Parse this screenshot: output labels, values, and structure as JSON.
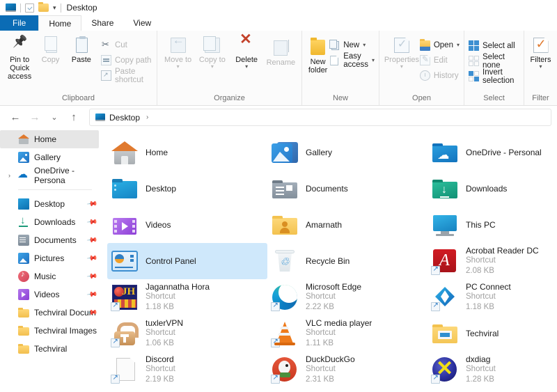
{
  "titlebar": {
    "title": "Desktop",
    "icons": [
      "desktop-icon",
      "checkbox-icon",
      "folder-icon",
      "dropdown-caret"
    ]
  },
  "ribbon_tabs": [
    {
      "label": "File",
      "active": false,
      "accent": true
    },
    {
      "label": "Home",
      "active": true
    },
    {
      "label": "Share",
      "active": false
    },
    {
      "label": "View",
      "active": false
    }
  ],
  "ribbon": {
    "groups": [
      {
        "label": "Clipboard",
        "big": [
          {
            "label": "Pin to Quick access",
            "icon": "pin-icon",
            "disabled": false
          },
          {
            "label": "Copy",
            "icon": "copy-icon",
            "disabled": true
          },
          {
            "label": "Paste",
            "icon": "paste-icon",
            "disabled": false
          }
        ],
        "small": [
          {
            "label": "Cut",
            "icon": "scissors-icon",
            "disabled": true
          },
          {
            "label": "Copy path",
            "icon": "copy-path-icon",
            "disabled": true
          },
          {
            "label": "Paste shortcut",
            "icon": "paste-shortcut-icon",
            "disabled": true
          }
        ]
      },
      {
        "label": "Organize",
        "big": [
          {
            "label": "Move to",
            "icon": "move-to-icon",
            "disabled": true,
            "caret": true
          },
          {
            "label": "Copy to",
            "icon": "copy-to-icon",
            "disabled": true,
            "caret": true
          },
          {
            "label": "Delete",
            "icon": "delete-icon",
            "disabled": false,
            "caret": true
          },
          {
            "label": "Rename",
            "icon": "rename-icon",
            "disabled": true
          }
        ],
        "small": []
      },
      {
        "label": "New",
        "big": [
          {
            "label": "New folder",
            "icon": "new-folder-icon",
            "disabled": false
          }
        ],
        "small": [
          {
            "label": "New",
            "icon": "new-item-icon",
            "disabled": false,
            "caret": true
          },
          {
            "label": "Easy access",
            "icon": "easy-access-icon",
            "disabled": false,
            "caret": true
          }
        ]
      },
      {
        "label": "Open",
        "big": [
          {
            "label": "Properties",
            "icon": "properties-icon",
            "disabled": true,
            "caret": true
          }
        ],
        "small": [
          {
            "label": "Open",
            "icon": "open-icon",
            "disabled": false,
            "caret": true
          },
          {
            "label": "Edit",
            "icon": "edit-icon",
            "disabled": true
          },
          {
            "label": "History",
            "icon": "history-icon",
            "disabled": true
          }
        ]
      },
      {
        "label": "Select",
        "big": [],
        "small": [
          {
            "label": "Select all",
            "icon": "select-all-icon",
            "disabled": false
          },
          {
            "label": "Select none",
            "icon": "select-none-icon",
            "disabled": false
          },
          {
            "label": "Invert selection",
            "icon": "invert-selection-icon",
            "disabled": false
          }
        ]
      },
      {
        "label": "Filter",
        "big": [
          {
            "label": "Filters",
            "icon": "filters-icon",
            "disabled": false,
            "caret": true
          }
        ],
        "small": []
      }
    ]
  },
  "addressbar": {
    "back": "←",
    "forward": "→",
    "recent": "⌄",
    "up": "↑",
    "path_icon": "desktop-icon",
    "path": "Desktop",
    "chevron": "›"
  },
  "sidebar": {
    "items": [
      {
        "label": "Home",
        "icon": "home-icon",
        "selected": true,
        "pinned": false,
        "expandable": false
      },
      {
        "label": "Gallery",
        "icon": "gallery-icon",
        "selected": false,
        "pinned": false,
        "expandable": false
      },
      {
        "label": "OneDrive - Persona",
        "icon": "onedrive-cloud-icon",
        "selected": false,
        "pinned": false,
        "expandable": true
      },
      {
        "separator": true
      },
      {
        "label": "Desktop",
        "icon": "desktop-folder-icon",
        "selected": false,
        "pinned": true,
        "expandable": false
      },
      {
        "label": "Downloads",
        "icon": "downloads-icon",
        "selected": false,
        "pinned": true,
        "expandable": false
      },
      {
        "label": "Documents",
        "icon": "documents-icon",
        "selected": false,
        "pinned": true,
        "expandable": false
      },
      {
        "label": "Pictures",
        "icon": "pictures-icon",
        "selected": false,
        "pinned": true,
        "expandable": false
      },
      {
        "label": "Music",
        "icon": "music-icon",
        "selected": false,
        "pinned": true,
        "expandable": false
      },
      {
        "label": "Videos",
        "icon": "videos-icon",
        "selected": false,
        "pinned": true,
        "expandable": false
      },
      {
        "label": "Techviral Docum",
        "icon": "folder-icon",
        "selected": false,
        "pinned": true,
        "expandable": false
      },
      {
        "label": "Techviral Images",
        "icon": "folder-icon",
        "selected": false,
        "pinned": false,
        "expandable": false
      },
      {
        "label": "Techviral",
        "icon": "folder-icon",
        "selected": false,
        "pinned": false,
        "expandable": false
      }
    ]
  },
  "files": [
    {
      "name": "Home",
      "type": "",
      "size": "",
      "icon": "home-icon",
      "shortcut": false,
      "selected": false
    },
    {
      "name": "Gallery",
      "type": "",
      "size": "",
      "icon": "gallery-icon",
      "shortcut": false,
      "selected": false
    },
    {
      "name": "OneDrive - Personal",
      "type": "",
      "size": "",
      "icon": "onedrive-folder-icon",
      "shortcut": false,
      "selected": false
    },
    {
      "name": "Desktop",
      "type": "",
      "size": "",
      "icon": "desktop-folder-icon",
      "shortcut": false,
      "selected": false
    },
    {
      "name": "Documents",
      "type": "",
      "size": "",
      "icon": "documents-folder-icon",
      "shortcut": false,
      "selected": false
    },
    {
      "name": "Downloads",
      "type": "",
      "size": "",
      "icon": "downloads-folder-icon",
      "shortcut": false,
      "selected": false
    },
    {
      "name": "Videos",
      "type": "",
      "size": "",
      "icon": "videos-folder-icon",
      "shortcut": false,
      "selected": false
    },
    {
      "name": "Amarnath",
      "type": "",
      "size": "",
      "icon": "user-folder-icon",
      "shortcut": false,
      "selected": false
    },
    {
      "name": "This PC",
      "type": "",
      "size": "",
      "icon": "this-pc-icon",
      "shortcut": false,
      "selected": false
    },
    {
      "name": "Control Panel",
      "type": "",
      "size": "",
      "icon": "control-panel-icon",
      "shortcut": false,
      "selected": true
    },
    {
      "name": "Recycle Bin",
      "type": "",
      "size": "",
      "icon": "recycle-bin-icon",
      "shortcut": false,
      "selected": false
    },
    {
      "name": "Acrobat Reader DC",
      "type": "Shortcut",
      "size": "2.08 KB",
      "icon": "acrobat-icon",
      "shortcut": true,
      "selected": false
    },
    {
      "name": "Jagannatha Hora",
      "type": "Shortcut",
      "size": "1.18 KB",
      "icon": "jagannatha-hora-icon",
      "shortcut": true,
      "selected": false
    },
    {
      "name": "Microsoft Edge",
      "type": "Shortcut",
      "size": "2.22 KB",
      "icon": "edge-icon",
      "shortcut": true,
      "selected": false
    },
    {
      "name": "PC Connect",
      "type": "Shortcut",
      "size": "1.18 KB",
      "icon": "pc-connect-icon",
      "shortcut": true,
      "selected": false
    },
    {
      "name": "tuxlerVPN",
      "type": "Shortcut",
      "size": "1.06 KB",
      "icon": "tuxler-vpn-icon",
      "shortcut": true,
      "selected": false
    },
    {
      "name": "VLC media player",
      "type": "Shortcut",
      "size": "1.11 KB",
      "icon": "vlc-icon",
      "shortcut": true,
      "selected": false
    },
    {
      "name": "Techviral",
      "type": "",
      "size": "",
      "icon": "techviral-folder-icon",
      "shortcut": false,
      "selected": false
    },
    {
      "name": "Discord",
      "type": "Shortcut",
      "size": "2.19 KB",
      "icon": "discord-generic-icon",
      "shortcut": true,
      "selected": false
    },
    {
      "name": "DuckDuckGo",
      "type": "Shortcut",
      "size": "2.31 KB",
      "icon": "duckduckgo-icon",
      "shortcut": true,
      "selected": false
    },
    {
      "name": "dxdiag",
      "type": "Shortcut",
      "size": "1.28 KB",
      "icon": "dxdiag-icon",
      "shortcut": true,
      "selected": false
    }
  ],
  "colors": {
    "accent": "#0b6cb5",
    "selection": "#cfe8fb",
    "sidebar_selection": "#e6e6e6",
    "ribbon_bg": "#fbfbfb",
    "subtext": "#a0a0a0"
  }
}
